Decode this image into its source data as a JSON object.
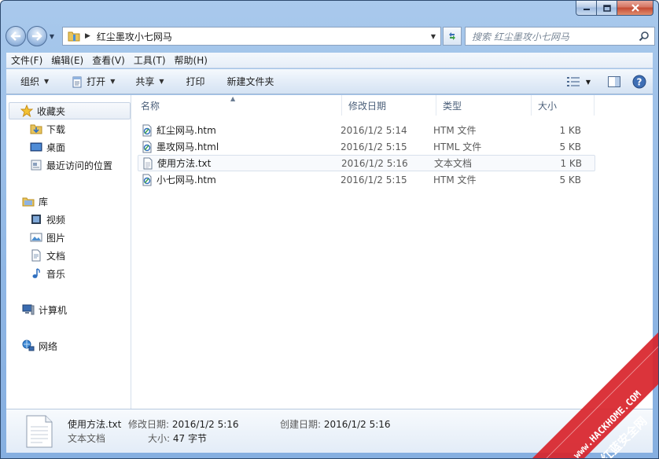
{
  "address": {
    "path": "红尘墨攻小七网马"
  },
  "search": {
    "placeholder": "搜索 红尘墨攻小七网马"
  },
  "menu": [
    "文件(F)",
    "编辑(E)",
    "查看(V)",
    "工具(T)",
    "帮助(H)"
  ],
  "toolbar": {
    "organize": "组织",
    "open": "打开",
    "share": "共享",
    "print": "打印",
    "new_folder": "新建文件夹"
  },
  "nav": {
    "favorites": "收藏夹",
    "downloads": "下载",
    "desktop": "桌面",
    "recent": "最近访问的位置",
    "libraries": "库",
    "videos": "视频",
    "pictures": "图片",
    "documents": "文档",
    "music": "音乐",
    "computer": "计算机",
    "network": "网络"
  },
  "columns": {
    "name": "名称",
    "date": "修改日期",
    "type": "类型",
    "size": "大小"
  },
  "files": [
    {
      "name": "紅尘网马.htm",
      "date": "2016/1/2 5:14",
      "type": "HTM 文件",
      "size": "1 KB",
      "icon": "html-file-icon"
    },
    {
      "name": "墨攻网马.html",
      "date": "2016/1/2 5:15",
      "type": "HTML 文件",
      "size": "5 KB",
      "icon": "html-file-icon"
    },
    {
      "name": "使用方法.txt",
      "date": "2016/1/2 5:16",
      "type": "文本文档",
      "size": "1 KB",
      "icon": "text-file-icon"
    },
    {
      "name": "小七网马.htm",
      "date": "2016/1/2 5:15",
      "type": "HTM 文件",
      "size": "5 KB",
      "icon": "html-file-icon"
    }
  ],
  "details": {
    "name": "使用方法.txt",
    "type": "文本文档",
    "modified_label": "修改日期:",
    "modified": "2016/1/2 5:16",
    "created_label": "创建日期:",
    "created": "2016/1/2 5:16",
    "size_label": "大小:",
    "size": "47 字节"
  },
  "watermark": {
    "line1": "www.HACKHOME.COM",
    "line2": "红蓝安全网"
  },
  "colors": {
    "accent": "#2b6fd1",
    "frame": "#9dbfe6",
    "watermark_red": "#d8232a"
  }
}
